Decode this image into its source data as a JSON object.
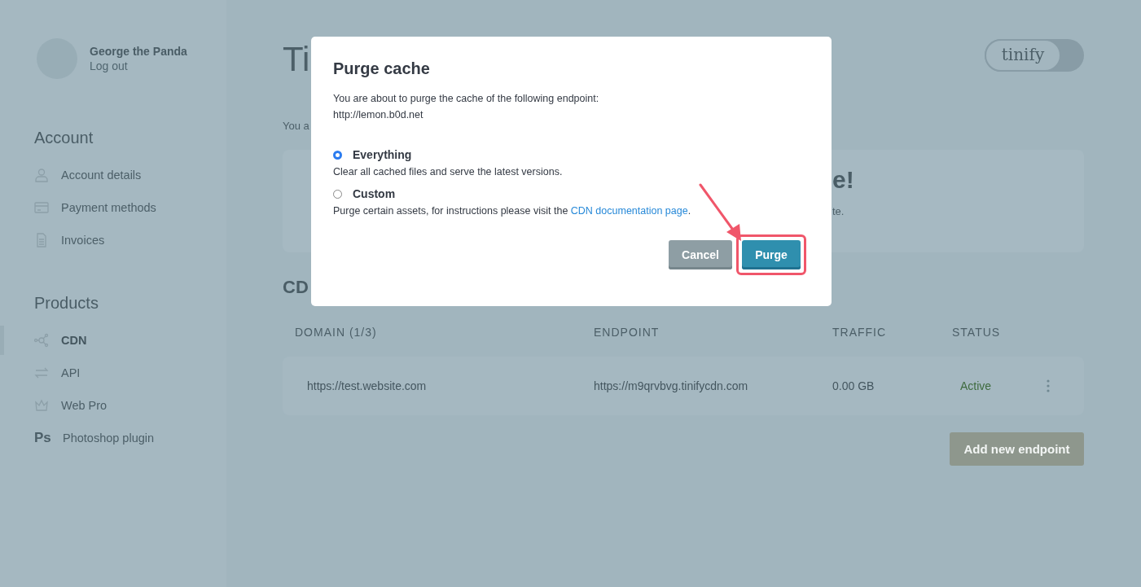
{
  "sidebar": {
    "user": {
      "name": "George the Panda",
      "logout": "Log out"
    },
    "sections": [
      {
        "heading": "Account",
        "items": [
          {
            "label": "Account details",
            "selected": false
          },
          {
            "label": "Payment methods",
            "selected": false
          },
          {
            "label": "Invoices",
            "selected": false
          }
        ]
      },
      {
        "heading": "Products",
        "items": [
          {
            "label": "CDN",
            "selected": true
          },
          {
            "label": "API",
            "selected": false
          },
          {
            "label": "Web Pro",
            "selected": false
          },
          {
            "label": "Photoshop plugin",
            "selected": false,
            "icon_text": "Ps"
          }
        ]
      }
    ]
  },
  "main": {
    "title_fragment": "Ti",
    "logo": "tinify",
    "intro_fragment": "You a",
    "card": {
      "heading_fragment": "e!",
      "text_fragment": "te."
    },
    "section_heading_fragment": "CD",
    "table": {
      "columns": [
        "DOMAIN (1/3)",
        "ENDPOINT",
        "TRAFFIC",
        "STATUS"
      ],
      "rows": [
        {
          "domain": "https://test.website.com",
          "endpoint": "https://m9qrvbvg.tinifycdn.com",
          "traffic": "0.00 GB",
          "status": "Active"
        }
      ]
    },
    "add_button": "Add new endpoint"
  },
  "dialog": {
    "title": "Purge cache",
    "message": "You are about to purge the cache of the following endpoint:",
    "endpoint": "http://lemon.b0d.net",
    "options": [
      {
        "label": "Everything",
        "description": "Clear all cached files and serve the latest versions.",
        "selected": true
      },
      {
        "label": "Custom",
        "description": "Purge certain assets, for instructions please visit the ",
        "link": "CDN documentation page",
        "suffix": ".",
        "selected": false
      }
    ],
    "buttons": [
      {
        "label": "Cancel",
        "kind": "secondary",
        "highlighted": false
      },
      {
        "label": "Purge",
        "kind": "primary",
        "highlighted": true
      }
    ]
  }
}
